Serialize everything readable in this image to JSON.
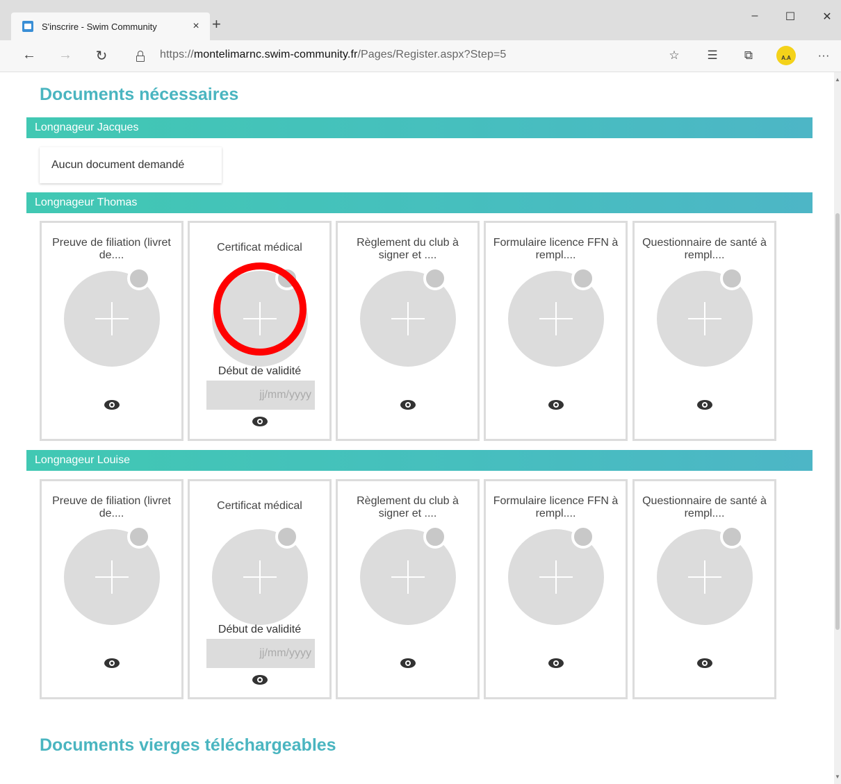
{
  "browser": {
    "tab_title": "S'inscrire - Swim Community",
    "tab_close": "×",
    "new_tab": "+",
    "minimize": "–",
    "maximize": "☐",
    "close": "✕",
    "back": "←",
    "forward": "→",
    "refresh": "↻",
    "url_prefix": "https://",
    "url_host": "montelimarnc.swim-community.fr",
    "url_path": "/Pages/Register.aspx?Step=5",
    "favorite_icon": "☆",
    "favorites_icon": "☰",
    "collections_icon": "⧉",
    "profile_initials": "A.A",
    "more": "···"
  },
  "page": {
    "section_required_title": "Documents nécessaires",
    "section_blank_title": "Documents vierges téléchargeables",
    "swimmers": [
      {
        "name": "Longnageur Jacques",
        "no_document_text": "Aucun document demandé"
      },
      {
        "name": "Longnageur Thomas",
        "documents": [
          {
            "title": "Preuve de filiation (livret de...."
          },
          {
            "title": "Certificat médical",
            "validity_label": "Début de validité",
            "date_placeholder": "jj/mm/yyyy"
          },
          {
            "title": "Règlement du club à signer et ...."
          },
          {
            "title": "Formulaire licence FFN à rempl...."
          },
          {
            "title": "Questionnaire de santé à rempl...."
          }
        ]
      },
      {
        "name": "Longnageur Louise",
        "documents": [
          {
            "title": "Preuve de filiation (livret de...."
          },
          {
            "title": "Certificat médical",
            "validity_label": "Début de validité",
            "date_placeholder": "jj/mm/yyyy"
          },
          {
            "title": "Règlement du club à signer et ...."
          },
          {
            "title": "Formulaire licence FFN à rempl...."
          },
          {
            "title": "Questionnaire de santé à rempl...."
          }
        ]
      }
    ]
  },
  "icons": {
    "upload": "plus-icon",
    "preview": "eye-icon",
    "status": "status-dot-icon",
    "annotation": "red-highlight-circle"
  },
  "colors": {
    "accent_title": "#4ab5c0",
    "band_start": "#41c8b3",
    "band_end": "#4db6c6",
    "placeholder_grey": "#dcdcdc",
    "highlight": "#ff0000"
  }
}
